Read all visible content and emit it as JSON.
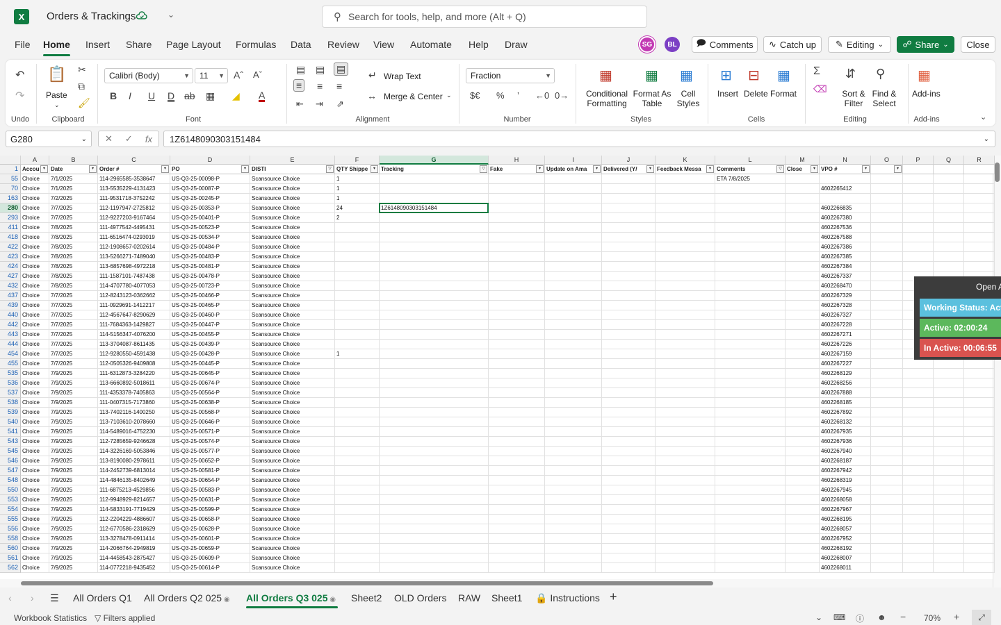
{
  "app": {
    "title": "Orders & Trackings",
    "search_placeholder": "Search for tools, help, and more (Alt + Q)"
  },
  "menu": [
    "File",
    "Home",
    "Insert",
    "Share",
    "Page Layout",
    "Formulas",
    "Data",
    "Review",
    "View",
    "Automate",
    "Help",
    "Draw"
  ],
  "menu_active": "Home",
  "avatars": [
    {
      "initials": "SG",
      "color": "#c239b3"
    },
    {
      "initials": "BL",
      "color": "#7b3fc4"
    }
  ],
  "top_buttons": {
    "comments": "Comments",
    "catch_up": "Catch up",
    "editing": "Editing",
    "share": "Share",
    "close": "Close"
  },
  "ribbon": {
    "undo_label": "Undo",
    "clipboard_label": "Clipboard",
    "paste": "Paste",
    "font_label": "Font",
    "font_name": "Calibri (Body)",
    "font_size": "11",
    "alignment_label": "Alignment",
    "wrap_text": "Wrap Text",
    "merge_center": "Merge & Center",
    "number_label": "Number",
    "number_format": "Fraction",
    "styles_label": "Styles",
    "conditional_formatting": [
      "Conditional",
      "Formatting"
    ],
    "format_as_table": [
      "Format As",
      "Table"
    ],
    "cell_styles": [
      "Cell",
      "Styles"
    ],
    "cells_label": "Cells",
    "insert": "Insert",
    "delete": "Delete",
    "format": "Format",
    "editing_label": "Editing",
    "sort_filter": [
      "Sort &",
      "Filter"
    ],
    "find_select": [
      "Find &",
      "Select"
    ],
    "addins_label": "Add-ins",
    "addins": "Add-ins"
  },
  "formula_bar": {
    "name_box": "G280",
    "value": "1Z6148090303151484"
  },
  "columns": [
    {
      "letter": "A",
      "header": "Accou",
      "w": 41
    },
    {
      "letter": "B",
      "header": "Date",
      "w": 70
    },
    {
      "letter": "C",
      "header": "Order #",
      "w": 104
    },
    {
      "letter": "D",
      "header": "PO",
      "w": 115
    },
    {
      "letter": "E",
      "header": "DISTI",
      "w": 122
    },
    {
      "letter": "F",
      "header": "QTY Shippe",
      "w": 64
    },
    {
      "letter": "G",
      "header": "Tracking",
      "w": 157
    },
    {
      "letter": "H",
      "header": "Fake",
      "w": 81
    },
    {
      "letter": "I",
      "header": "Update on Ama",
      "w": 82
    },
    {
      "letter": "J",
      "header": "Delivered (Y/",
      "w": 77
    },
    {
      "letter": "K",
      "header": "Feedback Messa",
      "w": 86
    },
    {
      "letter": "L",
      "header": "Comments",
      "w": 101
    },
    {
      "letter": "M",
      "header": "Close",
      "w": 49
    },
    {
      "letter": "N",
      "header": "VPO #",
      "w": 74
    },
    {
      "letter": "O",
      "header": "",
      "w": 46
    },
    {
      "letter": "P",
      "header": "",
      "w": 44
    },
    {
      "letter": "Q",
      "header": "",
      "w": 44
    },
    {
      "letter": "R",
      "header": "",
      "w": 44
    }
  ],
  "filtered_columns": [
    "E",
    "G",
    "L"
  ],
  "rows": [
    {
      "n": "55",
      "a": "Choice",
      "b": "7/1/2025",
      "c": "114-2965585-3538647",
      "d": "US-Q3-25-00098-P",
      "e": "Scansource Choice",
      "f": "1",
      "g": "",
      "l": "ETA 7/8/2025",
      "vpo": ""
    },
    {
      "n": "70",
      "a": "Choice",
      "b": "7/1/2025",
      "c": "113-5535229-4131423",
      "d": "US-Q3-25-00087-P",
      "e": "Scansource Choice",
      "f": "1",
      "g": "",
      "l": "",
      "vpo": "4602265412"
    },
    {
      "n": "163",
      "a": "Choice",
      "b": "7/2/2025",
      "c": "111-9531718-3752242",
      "d": "US-Q3-25-00245-P",
      "e": "Scansource Choice",
      "f": "1",
      "g": "",
      "l": "",
      "vpo": ""
    },
    {
      "n": "280",
      "a": "Choice",
      "b": "7/7/2025",
      "c": "112-1197947-2725812",
      "d": "US-Q3-25-00353-P",
      "e": "Scansource Choice",
      "f": "24",
      "g": "1Z6148090303151484",
      "l": "",
      "vpo": "4602266835"
    },
    {
      "n": "293",
      "a": "Choice",
      "b": "7/7/2025",
      "c": "112-9227203-9167464",
      "d": "US-Q3-25-00401-P",
      "e": "Scansource Choice",
      "f": "2",
      "g": "",
      "l": "",
      "vpo": "4602267380"
    },
    {
      "n": "411",
      "a": "Choice",
      "b": "7/8/2025",
      "c": "111-4977542-4495431",
      "d": "US-Q3-25-00523-P",
      "e": "Scansource Choice",
      "f": "",
      "g": "",
      "l": "",
      "vpo": "4602267536"
    },
    {
      "n": "418",
      "a": "Choice",
      "b": "7/8/2025",
      "c": "111-6516474-0293019",
      "d": "US-Q3-25-00534-P",
      "e": "Scansource Choice",
      "f": "",
      "g": "",
      "l": "",
      "vpo": "4602267588"
    },
    {
      "n": "422",
      "a": "Choice",
      "b": "7/8/2025",
      "c": "112-1908657-0202614",
      "d": "US-Q3-25-00484-P",
      "e": "Scansource Choice",
      "f": "",
      "g": "",
      "l": "",
      "vpo": "4602267386"
    },
    {
      "n": "423",
      "a": "Choice",
      "b": "7/8/2025",
      "c": "113-5266271-7489040",
      "d": "US-Q3-25-00483-P",
      "e": "Scansource Choice",
      "f": "",
      "g": "",
      "l": "",
      "vpo": "4602267385"
    },
    {
      "n": "424",
      "a": "Choice",
      "b": "7/8/2025",
      "c": "113-6857698-4972218",
      "d": "US-Q3-25-00481-P",
      "e": "Scansource Choice",
      "f": "",
      "g": "",
      "l": "",
      "vpo": "4602267384"
    },
    {
      "n": "427",
      "a": "Choice",
      "b": "7/8/2025",
      "c": "111-1587101-7487438",
      "d": "US-Q3-25-00478-P",
      "e": "Scansource Choice",
      "f": "",
      "g": "",
      "l": "",
      "vpo": "4602267337"
    },
    {
      "n": "432",
      "a": "Choice",
      "b": "7/8/2025",
      "c": "114-4707780-4077053",
      "d": "US-Q3-25-00723-P",
      "e": "Scansource Choice",
      "f": "",
      "g": "",
      "l": "",
      "vpo": "4602268470"
    },
    {
      "n": "437",
      "a": "Choice",
      "b": "7/7/2025",
      "c": "112-8243123-0362662",
      "d": "US-Q3-25-00466-P",
      "e": "Scansource Choice",
      "f": "",
      "g": "",
      "l": "",
      "vpo": "4602267329"
    },
    {
      "n": "439",
      "a": "Choice",
      "b": "7/7/2025",
      "c": "111-0929691-1412217",
      "d": "US-Q3-25-00465-P",
      "e": "Scansource Choice",
      "f": "",
      "g": "",
      "l": "",
      "vpo": "4602267328"
    },
    {
      "n": "440",
      "a": "Choice",
      "b": "7/7/2025",
      "c": "112-4567647-8290629",
      "d": "US-Q3-25-00460-P",
      "e": "Scansource Choice",
      "f": "",
      "g": "",
      "l": "",
      "vpo": "4602267327"
    },
    {
      "n": "442",
      "a": "Choice",
      "b": "7/7/2025",
      "c": "111-7684363-1429827",
      "d": "US-Q3-25-00447-P",
      "e": "Scansource Choice",
      "f": "",
      "g": "",
      "l": "",
      "vpo": "4602267228"
    },
    {
      "n": "443",
      "a": "Choice",
      "b": "7/7/2025",
      "c": "114-5156347-4076200",
      "d": "US-Q3-25-00455-P",
      "e": "Scansource Choice",
      "f": "",
      "g": "",
      "l": "",
      "vpo": "4602267271"
    },
    {
      "n": "444",
      "a": "Choice",
      "b": "7/7/2025",
      "c": "113-3704087-8611435",
      "d": "US-Q3-25-00439-P",
      "e": "Scansource Choice",
      "f": "",
      "g": "",
      "l": "",
      "vpo": "4602267226"
    },
    {
      "n": "454",
      "a": "Choice",
      "b": "7/7/2025",
      "c": "112-9280550-4591438",
      "d": "US-Q3-25-00428-P",
      "e": "Scansource Choice",
      "f": "1",
      "g": "",
      "l": "",
      "vpo": "4602267159"
    },
    {
      "n": "455",
      "a": "Choice",
      "b": "7/7/2025",
      "c": "112-0505326-9409808",
      "d": "US-Q3-25-00445-P",
      "e": "Scansource Choice",
      "f": "",
      "g": "",
      "l": "",
      "vpo": "4602267227"
    },
    {
      "n": "535",
      "a": "Choice",
      "b": "7/9/2025",
      "c": "111-6312873-3284220",
      "d": "US-Q3-25-00645-P",
      "e": "Scansource Choice",
      "f": "",
      "g": "",
      "l": "",
      "vpo": "4602268129"
    },
    {
      "n": "536",
      "a": "Choice",
      "b": "7/9/2025",
      "c": "113-6660892-5018611",
      "d": "US-Q3-25-00674-P",
      "e": "Scansource Choice",
      "f": "",
      "g": "",
      "l": "",
      "vpo": "4602268256"
    },
    {
      "n": "537",
      "a": "Choice",
      "b": "7/9/2025",
      "c": "111-4353378-7405863",
      "d": "US-Q3-25-00564-P",
      "e": "Scansource Choice",
      "f": "",
      "g": "",
      "l": "",
      "vpo": "4602267888"
    },
    {
      "n": "538",
      "a": "Choice",
      "b": "7/9/2025",
      "c": "111-0407315-7173860",
      "d": "US-Q3-25-00638-P",
      "e": "Scansource Choice",
      "f": "",
      "g": "",
      "l": "",
      "vpo": "4602268185"
    },
    {
      "n": "539",
      "a": "Choice",
      "b": "7/9/2025",
      "c": "113-7402116-1400250",
      "d": "US-Q3-25-00568-P",
      "e": "Scansource Choice",
      "f": "",
      "g": "",
      "l": "",
      "vpo": "4602267892"
    },
    {
      "n": "540",
      "a": "Choice",
      "b": "7/9/2025",
      "c": "113-7103610-2078660",
      "d": "US-Q3-25-00646-P",
      "e": "Scansource Choice",
      "f": "",
      "g": "",
      "l": "",
      "vpo": "4602268132"
    },
    {
      "n": "541",
      "a": "Choice",
      "b": "7/9/2025",
      "c": "114-5489016-4752230",
      "d": "US-Q3-25-00571-P",
      "e": "Scansource Choice",
      "f": "",
      "g": "",
      "l": "",
      "vpo": "4602267935"
    },
    {
      "n": "543",
      "a": "Choice",
      "b": "7/9/2025",
      "c": "112-7285659-9246628",
      "d": "US-Q3-25-00574-P",
      "e": "Scansource Choice",
      "f": "",
      "g": "",
      "l": "",
      "vpo": "4602267936"
    },
    {
      "n": "545",
      "a": "Choice",
      "b": "7/9/2025",
      "c": "114-3226169-5053846",
      "d": "US-Q3-25-00577-P",
      "e": "Scansource Choice",
      "f": "",
      "g": "",
      "l": "",
      "vpo": "4602267940"
    },
    {
      "n": "546",
      "a": "Choice",
      "b": "7/9/2025",
      "c": "113-8190080-2978611",
      "d": "US-Q3-25-00652-P",
      "e": "Scansource Choice",
      "f": "",
      "g": "",
      "l": "",
      "vpo": "4602268187"
    },
    {
      "n": "547",
      "a": "Choice",
      "b": "7/9/2025",
      "c": "114-2452739-6813014",
      "d": "US-Q3-25-00581-P",
      "e": "Scansource Choice",
      "f": "",
      "g": "",
      "l": "",
      "vpo": "4602267942"
    },
    {
      "n": "548",
      "a": "Choice",
      "b": "7/9/2025",
      "c": "114-4846135-8402649",
      "d": "US-Q3-25-00654-P",
      "e": "Scansource Choice",
      "f": "",
      "g": "",
      "l": "",
      "vpo": "4602268319"
    },
    {
      "n": "550",
      "a": "Choice",
      "b": "7/9/2025",
      "c": "111-6875213-4529856",
      "d": "US-Q3-25-00583-P",
      "e": "Scansource Choice",
      "f": "",
      "g": "",
      "l": "",
      "vpo": "4602267945"
    },
    {
      "n": "553",
      "a": "Choice",
      "b": "7/9/2025",
      "c": "112-9948929-8214657",
      "d": "US-Q3-25-00631-P",
      "e": "Scansource Choice",
      "f": "",
      "g": "",
      "l": "",
      "vpo": "4602268058"
    },
    {
      "n": "554",
      "a": "Choice",
      "b": "7/9/2025",
      "c": "114-5833191-7719429",
      "d": "US-Q3-25-00599-P",
      "e": "Scansource Choice",
      "f": "",
      "g": "",
      "l": "",
      "vpo": "4602267967"
    },
    {
      "n": "555",
      "a": "Choice",
      "b": "7/9/2025",
      "c": "112-2204229-4886607",
      "d": "US-Q3-25-00658-P",
      "e": "Scansource Choice",
      "f": "",
      "g": "",
      "l": "",
      "vpo": "4602268195"
    },
    {
      "n": "556",
      "a": "Choice",
      "b": "7/9/2025",
      "c": "112-6770586-2318629",
      "d": "US-Q3-25-00628-P",
      "e": "Scansource Choice",
      "f": "",
      "g": "",
      "l": "",
      "vpo": "4602268057"
    },
    {
      "n": "558",
      "a": "Choice",
      "b": "7/9/2025",
      "c": "113-3278478-0911414",
      "d": "US-Q3-25-00601-P",
      "e": "Scansource Choice",
      "f": "",
      "g": "",
      "l": "",
      "vpo": "4602267952"
    },
    {
      "n": "560",
      "a": "Choice",
      "b": "7/9/2025",
      "c": "114-2066764-2949819",
      "d": "US-Q3-25-00659-P",
      "e": "Scansource Choice",
      "f": "",
      "g": "",
      "l": "",
      "vpo": "4602268192"
    },
    {
      "n": "561",
      "a": "Choice",
      "b": "7/9/2025",
      "c": "114-4458543-2875427",
      "d": "US-Q3-25-00609-P",
      "e": "Scansource Choice",
      "f": "",
      "g": "",
      "l": "",
      "vpo": "4602268007"
    },
    {
      "n": "562",
      "a": "Choice",
      "b": "7/9/2025",
      "c": "114-0772218-9435452",
      "d": "US-Q3-25-00614-P",
      "e": "Scansource Choice",
      "f": "",
      "g": "",
      "l": "",
      "vpo": "4602268011"
    }
  ],
  "overlay": {
    "open": "Open A",
    "working_status": "Working Status: Act",
    "active": "Active: 02:00:24",
    "inactive": "In Active: 00:06:55",
    "colors": {
      "working": "#5bc0de",
      "active": "#5cb85c",
      "inactive": "#d9534f"
    }
  },
  "sheets": [
    "All Orders Q1",
    "All Orders Q2 025",
    "All Orders Q3 025",
    "Sheet2",
    "OLD Orders",
    "RAW",
    "Sheet1",
    "Instructions"
  ],
  "sheet_active": "All Orders Q3 025",
  "status": {
    "workbook_stats": "Workbook Statistics",
    "filters": "Filters applied",
    "zoom": "70%"
  }
}
